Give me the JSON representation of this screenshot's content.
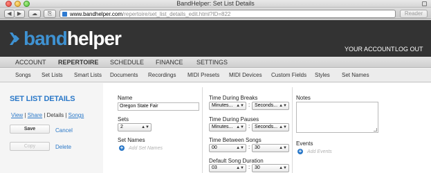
{
  "window": {
    "title": "BandHelper: Set List Details"
  },
  "toolbar": {
    "back_label": "◀",
    "forward_label": "▶",
    "cloud_label": "☁",
    "share_label": "⎘",
    "url_host": "www.bandhelper.com",
    "url_path": "/repertoire/set_list_details_edit.html?ID=822",
    "reader_label": "Reader"
  },
  "header": {
    "logo_band": "band",
    "logo_helper": "helper",
    "your_account": "YOUR ACCOUNT",
    "log_out": "LOG OUT"
  },
  "main_nav": [
    {
      "label": "ACCOUNT",
      "active": false
    },
    {
      "label": "REPERTOIRE",
      "active": true
    },
    {
      "label": "SCHEDULE",
      "active": false
    },
    {
      "label": "FINANCE",
      "active": false
    },
    {
      "label": "SETTINGS",
      "active": false
    }
  ],
  "sub_nav": [
    "Songs",
    "Set Lists",
    "Smart Lists",
    "Documents",
    "Recordings",
    "MIDI Presets",
    "MIDI Devices",
    "Custom Fields",
    "Styles",
    "Set Names"
  ],
  "left": {
    "title": "SET LIST DETAILS",
    "view_link": "View",
    "share_link": "Share",
    "details_text": "Details",
    "songs_link": "Songs",
    "separator": "|",
    "save": "Save",
    "cancel": "Cancel",
    "copy": "Copy",
    "delete": "Delete"
  },
  "form": {
    "name_label": "Name",
    "name_value": "Oregon State Fair",
    "sets_label": "Sets",
    "sets_value": "2",
    "set_names_label": "Set Names",
    "add_set_names": "Add Set Names",
    "breaks_label": "Time During Breaks",
    "breaks_minutes": "Minutes...",
    "breaks_seconds": "Seconds...",
    "pauses_label": "Time During Pauses",
    "pauses_minutes": "Minutes...",
    "pauses_seconds": "Seconds...",
    "between_label": "Time Between Songs",
    "between_minutes": "00",
    "between_seconds": "30",
    "duration_label": "Default Song Duration",
    "duration_minutes": "03",
    "duration_seconds": "30",
    "colon": ":",
    "notes_label": "Notes",
    "events_label": "Events",
    "add_events": "Add Events"
  },
  "icons": {
    "plus": "+",
    "select_arrows": "▲▼"
  },
  "colors": {
    "brand_blue": "#2a78c8",
    "header_bg": "#333333"
  }
}
